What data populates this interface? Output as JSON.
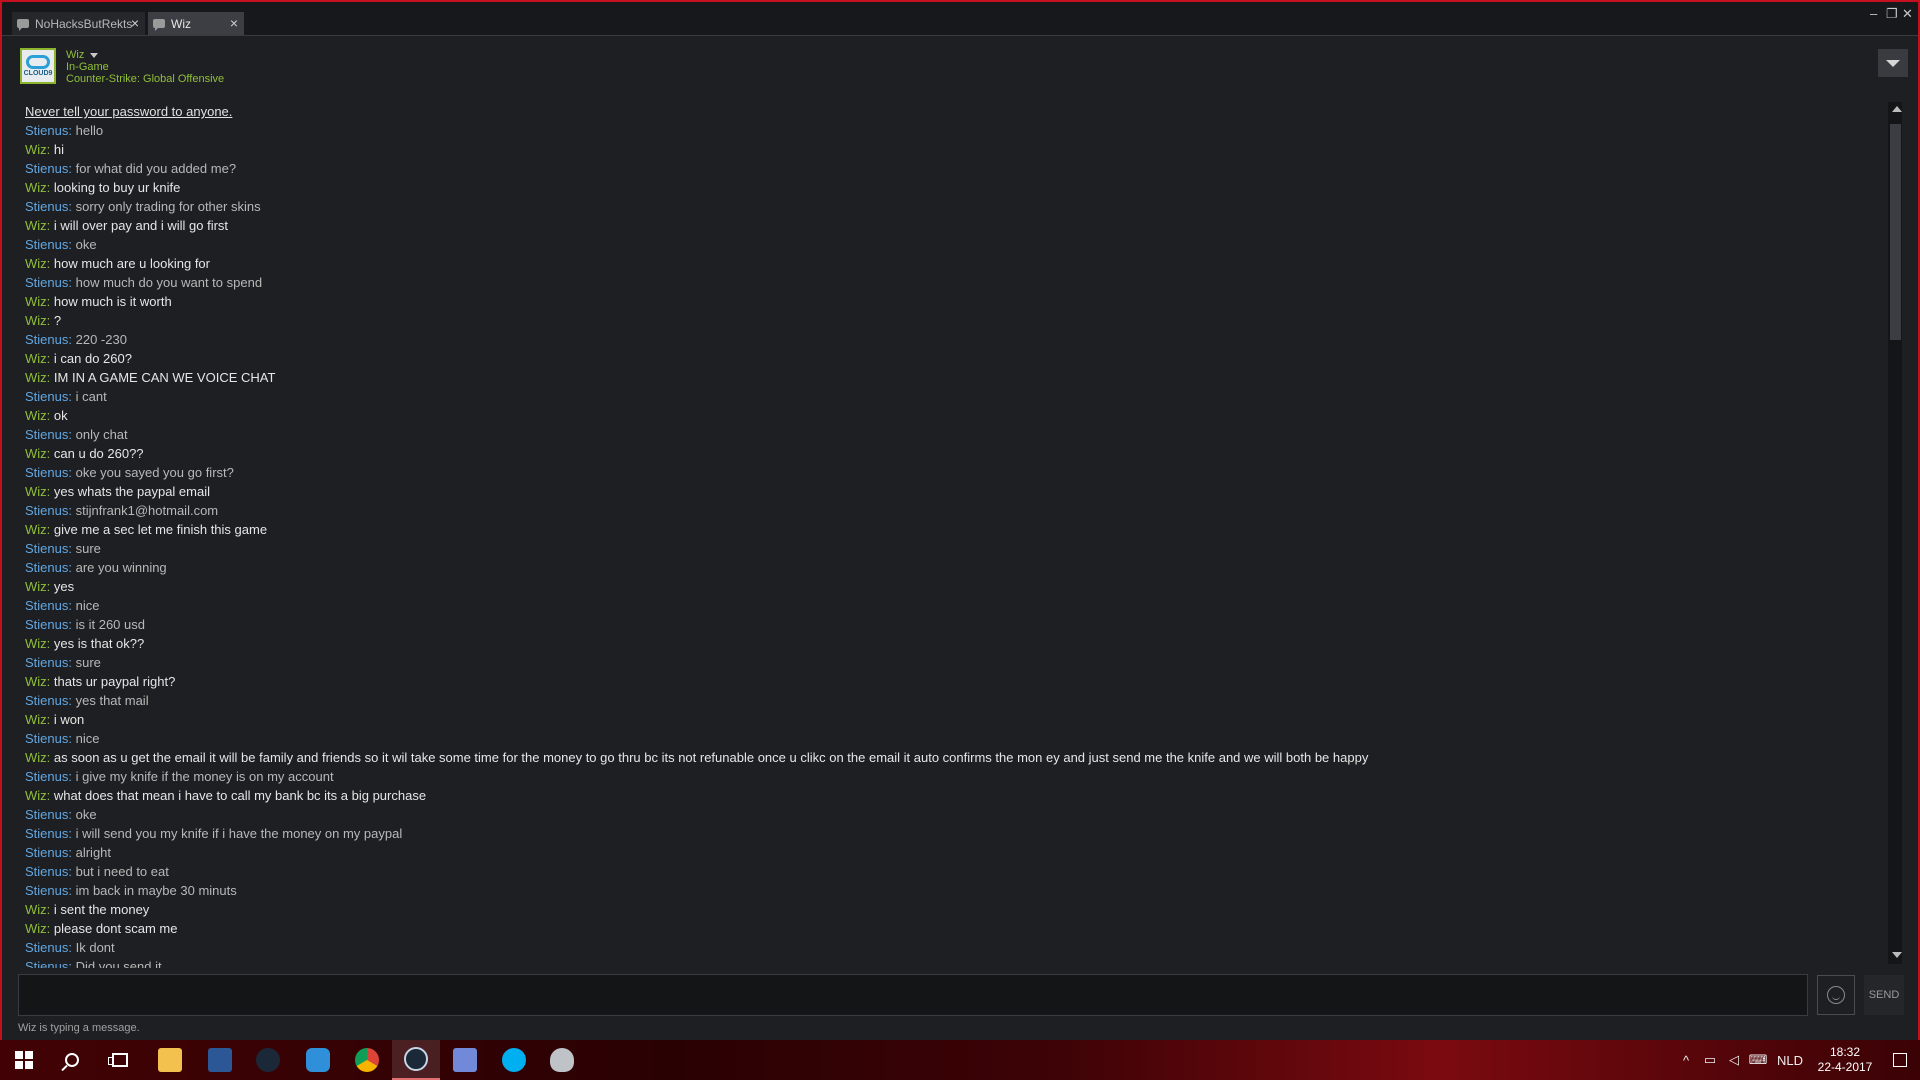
{
  "tabs": [
    {
      "label": "NoHacksButRekts",
      "active": false
    },
    {
      "label": "Wiz",
      "active": true
    }
  ],
  "window_controls": {
    "minimize": "–",
    "maximize": "❐",
    "close": "✕"
  },
  "friend": {
    "name": "Wiz",
    "status": "In-Game",
    "game": "Counter-Strike: Global Offensive",
    "avatar_text": "CLOUD9"
  },
  "warning": "Never tell your password to anyone.",
  "messages": [
    {
      "sender": "Stienus",
      "text": "hello"
    },
    {
      "sender": "Wiz",
      "text": "hi"
    },
    {
      "sender": "Stienus",
      "text": "for what did you added me?"
    },
    {
      "sender": "Wiz",
      "text": "looking to buy ur knife"
    },
    {
      "sender": "Stienus",
      "text": "sorry only trading for other skins"
    },
    {
      "sender": "Wiz",
      "text": "i will over pay and i will go first"
    },
    {
      "sender": "Stienus",
      "text": "oke"
    },
    {
      "sender": "Wiz",
      "text": "how much are u looking for"
    },
    {
      "sender": "Stienus",
      "text": "how much do you want to spend"
    },
    {
      "sender": "Wiz",
      "text": "how much is it worth"
    },
    {
      "sender": "Wiz",
      "text": "?"
    },
    {
      "sender": "Stienus",
      "text": "220 -230"
    },
    {
      "sender": "Wiz",
      "text": "i can do 260?"
    },
    {
      "sender": "Wiz",
      "text": "IM IN A GAME CAN WE VOICE CHAT"
    },
    {
      "sender": "Stienus",
      "text": "i cant"
    },
    {
      "sender": "Wiz",
      "text": "ok"
    },
    {
      "sender": "Stienus",
      "text": "only chat"
    },
    {
      "sender": "Wiz",
      "text": "can u do 260??"
    },
    {
      "sender": "Stienus",
      "text": "oke you sayed you go first?"
    },
    {
      "sender": "Wiz",
      "text": "yes whats the paypal email"
    },
    {
      "sender": "Stienus",
      "text": "stijnfrank1@hotmail.com"
    },
    {
      "sender": "Wiz",
      "text": "give me a sec let me finish this game"
    },
    {
      "sender": "Stienus",
      "text": "sure"
    },
    {
      "sender": "Stienus",
      "text": "are you winning"
    },
    {
      "sender": "Wiz",
      "text": "yes"
    },
    {
      "sender": "Stienus",
      "text": "nice"
    },
    {
      "sender": "Stienus",
      "text": "is it 260 usd"
    },
    {
      "sender": "Wiz",
      "text": "yes is that ok??"
    },
    {
      "sender": "Stienus",
      "text": "sure"
    },
    {
      "sender": "Wiz",
      "text": "thats ur paypal right?"
    },
    {
      "sender": "Stienus",
      "text": "yes that mail"
    },
    {
      "sender": "Wiz",
      "text": "i won"
    },
    {
      "sender": "Stienus",
      "text": "nice"
    },
    {
      "sender": "Wiz",
      "text": "as soon as u get the email it will be family and friends so it wil take some time for the money to go thru bc its not refunable once u clikc on the email it auto confirms the mon ey and just send me the knife and we will both be happy"
    },
    {
      "sender": "Stienus",
      "text": "i give my knife if the money is on my account"
    },
    {
      "sender": "Wiz",
      "text": "what does that mean i have to call my bank bc its a big purchase"
    },
    {
      "sender": "Stienus",
      "text": "oke"
    },
    {
      "sender": "Stienus",
      "text": "i will send you my knife if i have the money on my paypal"
    },
    {
      "sender": "Stienus",
      "text": "alright"
    },
    {
      "sender": "Stienus",
      "text": "but i need to eat"
    },
    {
      "sender": "Stienus",
      "text": "im back in maybe 30 minuts"
    },
    {
      "sender": "Wiz",
      "text": "i sent the money"
    },
    {
      "sender": "Wiz",
      "text": "please dont scam me"
    },
    {
      "sender": "Stienus",
      "text": "Ik dont"
    },
    {
      "sender": "Stienus",
      "text": "Did you send it"
    }
  ],
  "input": {
    "value": "",
    "placeholder": ""
  },
  "send_label": "SEND",
  "typing_status": "Wiz is typing a message.",
  "taskbar": {
    "apps": [
      "start",
      "search",
      "task-view",
      "file-explorer",
      "word",
      "steam-alt",
      "app-g",
      "chrome",
      "steam",
      "discord",
      "skype",
      "app-shield"
    ],
    "tray": {
      "language": "NLD",
      "time": "18:32",
      "date": "22-4-2017"
    }
  },
  "colors": {
    "wiz": "#8fbf3a",
    "stienus": "#62a7e3",
    "border": "#c4101f"
  }
}
